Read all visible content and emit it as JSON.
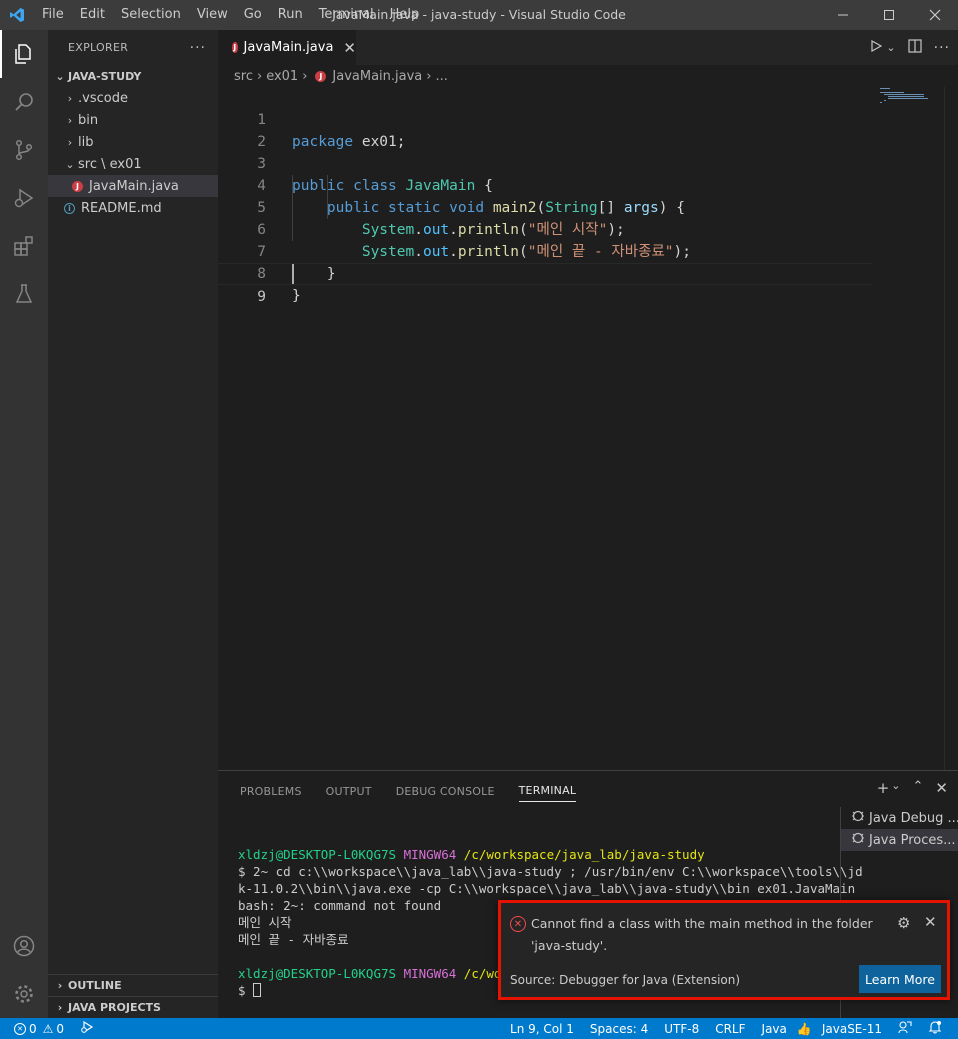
{
  "titlebar": {
    "menu": [
      "File",
      "Edit",
      "Selection",
      "View",
      "Go",
      "Run",
      "Terminal",
      "Help"
    ],
    "window_title": "JavaMain.java - java-study - Visual Studio Code"
  },
  "sidebar": {
    "header": "EXPLORER",
    "more": "···",
    "section": "JAVA-STUDY",
    "items": [
      {
        "label": ".vscode"
      },
      {
        "label": "bin"
      },
      {
        "label": "lib"
      },
      {
        "label": "src \\ ex01"
      },
      {
        "label": "JavaMain.java"
      },
      {
        "label": "README.md"
      }
    ],
    "outline": "OUTLINE",
    "java_projects": "JAVA PROJECTS"
  },
  "editor": {
    "tab_label": "JavaMain.java",
    "breadcrumb": [
      "src",
      "ex01",
      "JavaMain.java",
      "..."
    ],
    "lines": [
      {
        "n": "1"
      },
      {
        "n": "2"
      },
      {
        "n": "3"
      },
      {
        "n": "4"
      },
      {
        "n": "5"
      },
      {
        "n": "6"
      },
      {
        "n": "7"
      },
      {
        "n": "8"
      },
      {
        "n": "9"
      }
    ],
    "code": {
      "l1_kw": "package",
      "l1_pkg": " ex01;",
      "l3_kw1": "public",
      "l3_kw2": "class",
      "l3_cls": "JavaMain",
      "l3_brace": " {",
      "l4_kw1": "public",
      "l4_kw2": "static",
      "l4_kw3": "void",
      "l4_fn": "main2",
      "l4_p1": "(",
      "l4_cls": "String",
      "l4_p2": "[] ",
      "l4_var": "args",
      "l4_p3": ") {",
      "l5_cls": "System",
      "l5_dot1": ".",
      "l5_id": "out",
      "l5_dot2": ".",
      "l5_fn": "println",
      "l5_p1": "(",
      "l5_str": "\"메인 시작\"",
      "l5_p2": ");",
      "l6_cls": "System",
      "l6_dot1": ".",
      "l6_id": "out",
      "l6_dot2": ".",
      "l6_fn": "println",
      "l6_p1": "(",
      "l6_str": "\"메인 끝 - 자바종료\"",
      "l6_p2": ");",
      "l7": "    }",
      "l8": "}"
    }
  },
  "panel": {
    "tabs": [
      "PROBLEMS",
      "OUTPUT",
      "DEBUG CONSOLE",
      "TERMINAL"
    ],
    "terminal": {
      "prompt_user": "xldzj@DESKTOP-L0KQG7S",
      "prompt_env": "MINGW64",
      "prompt_path": "/c/workspace/java_lab/java-study",
      "cmd_line1": "$ 2~ cd c:\\\\workspace\\\\java_lab\\\\java-study ; /usr/bin/env C:\\\\workspace\\\\tools\\\\jd",
      "cmd_line2": "k-11.0.2\\\\bin\\\\java.exe -cp C:\\\\workspace\\\\java_lab\\\\java-study\\\\bin ex01.JavaMain",
      "out1": "bash: 2~: command not found",
      "out2": "메인 시작",
      "out3": "메인 끝 - 자바종료",
      "prompt2_path": "/c/work",
      "dollar": "$ "
    },
    "terminal_list": [
      "Java Debug ...",
      "Java Proces..."
    ]
  },
  "notification": {
    "message": "Cannot find a class with the main method in the folder 'java-study'.",
    "source": "Source: Debugger for Java (Extension)",
    "button": "Learn More"
  },
  "statusbar": {
    "errors": "0",
    "warnings": "0",
    "position": "Ln 9, Col 1",
    "spaces": "Spaces: 4",
    "encoding": "UTF-8",
    "eol": "CRLF",
    "language": "Java",
    "jdk": "JavaSE-11"
  },
  "colors": {
    "accent": "#007acc",
    "error": "#e51400",
    "button": "#0e639c"
  }
}
